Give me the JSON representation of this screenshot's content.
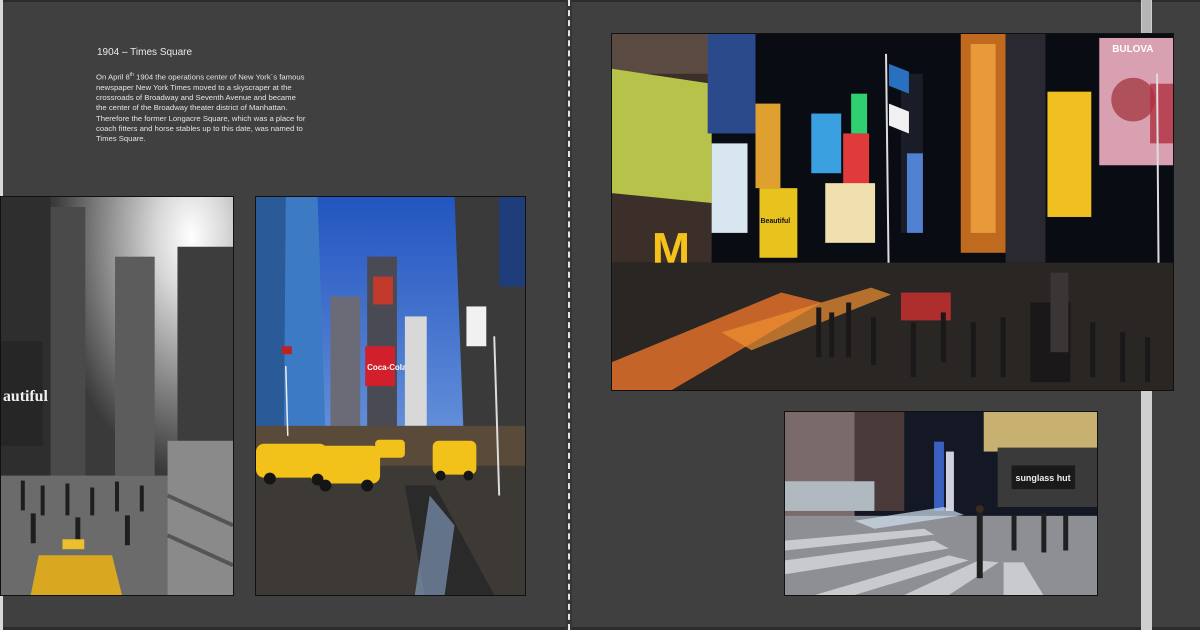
{
  "spread": {
    "caption": {
      "title": "1904 – Times Square",
      "body_line1_pre": "On April 8",
      "body_line1_sup": "th",
      "body_line1_post": " 1904 the operations center of New York´s",
      "body_rest": "famous newspaper New York Times moved to a skyscraper at the crossroads of Broadway and Seventh Avenue and became the center of the Broadway theater district of Manhattan. Therefore the former Longacre Square, which was a place for coach fitters and horse stables up to this date, was named to Times Square."
    },
    "photos": {
      "bw_street": {
        "sign_text": "autiful"
      },
      "taxi_street": {
        "sign_text": "Coca-Cola"
      },
      "night_square": {
        "sign_left": "Beautiful",
        "sign_right": "BULOVA",
        "mcd": "M"
      },
      "crosswalk": {
        "sign_text": "sunglass hut"
      }
    }
  },
  "colors": {
    "page_bg": "#404040",
    "gutter": "#353535",
    "caption_text": "#e9e9e9",
    "scrollbar": "#cfcfcf",
    "taxi_yellow": "#f2c21b",
    "sky_blue": "#2f6fd0",
    "night_sky": "#0a0c14"
  }
}
